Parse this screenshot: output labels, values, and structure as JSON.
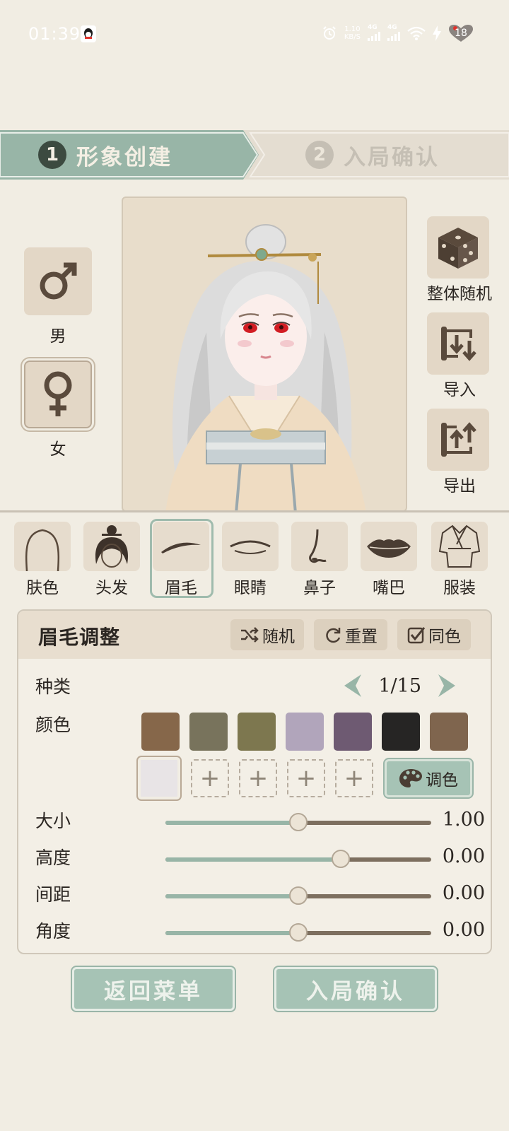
{
  "status_bar": {
    "time": "01:39",
    "net_speed_value": "1.10",
    "net_speed_unit": "KB/S",
    "signal1_label": "4G",
    "signal2_label": "4G",
    "battery_level": "18"
  },
  "steps": [
    {
      "number": "1",
      "label": "形象创建"
    },
    {
      "number": "2",
      "label": "入局确认"
    }
  ],
  "gender": {
    "male_label": "男",
    "female_label": "女",
    "selected": "女"
  },
  "actions": {
    "random_all_label": "整体随机",
    "import_label": "导入",
    "export_label": "导出"
  },
  "categories": [
    {
      "label": "肤色",
      "icon": "face-outline-icon"
    },
    {
      "label": "头发",
      "icon": "hair-icon"
    },
    {
      "label": "眉毛",
      "icon": "eyebrow-icon"
    },
    {
      "label": "眼睛",
      "icon": "eye-icon"
    },
    {
      "label": "鼻子",
      "icon": "nose-icon"
    },
    {
      "label": "嘴巴",
      "icon": "lips-icon"
    },
    {
      "label": "服装",
      "icon": "robe-icon"
    }
  ],
  "active_category": "眉毛",
  "panel": {
    "title": "眉毛调整",
    "random_label": "随机",
    "reset_label": "重置",
    "same_color_label": "同色",
    "same_color_checked": true,
    "type_label": "种类",
    "type_value": "1/15",
    "color_label": "颜色",
    "swatches": [
      "#86674a",
      "#78735c",
      "#7d774f",
      "#b1a5bb",
      "#6e5a72",
      "#262524",
      "#7f654e"
    ],
    "custom_swatch": "#e8e4e6",
    "palette_label": "调色",
    "sliders": [
      {
        "label": "大小",
        "value": "1.00",
        "level": 0.5
      },
      {
        "label": "高度",
        "value": "0.00",
        "level": 0.66
      },
      {
        "label": "间距",
        "value": "0.00",
        "level": 0.5
      },
      {
        "label": "角度",
        "value": "0.00",
        "level": 0.5
      }
    ]
  },
  "bottom": {
    "back_label": "返回菜单",
    "confirm_label": "入局确认"
  },
  "colors": {
    "accent_green": "#98b5a7",
    "background": "#f1ede3",
    "panel_header": "#e8decf"
  }
}
